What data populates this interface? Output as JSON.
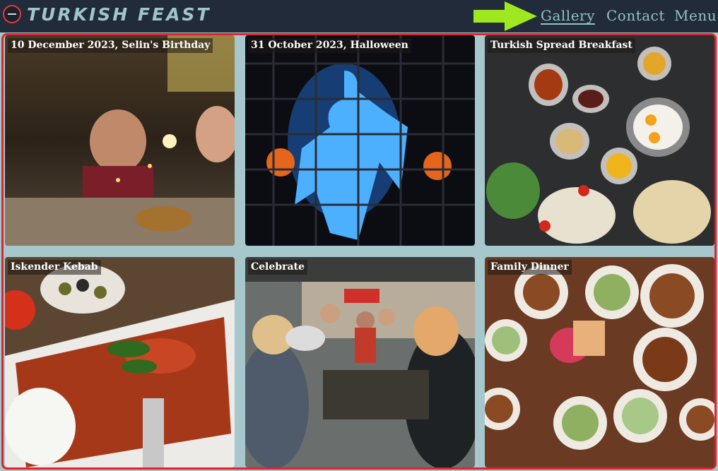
{
  "brand": {
    "name": "Turkish Feast"
  },
  "nav": {
    "links": [
      "Gallery",
      "Contact",
      "Menu"
    ],
    "active": "Gallery"
  },
  "gallery": {
    "items": [
      {
        "caption": "10 December 2023, Selin's Birthday"
      },
      {
        "caption": "31 October 2023, Halloween"
      },
      {
        "caption": "Turkish Spread Breakfast"
      },
      {
        "caption": "Iskender Kebab"
      },
      {
        "caption": "Celebrate"
      },
      {
        "caption": "Family Dinner"
      }
    ]
  },
  "colors": {
    "nav_bg": "#222b3a",
    "accent_text": "#8fc3c8",
    "page_bg": "#a6c8cc",
    "frame_border": "#e0232f",
    "arrow": "#9fe81f"
  }
}
